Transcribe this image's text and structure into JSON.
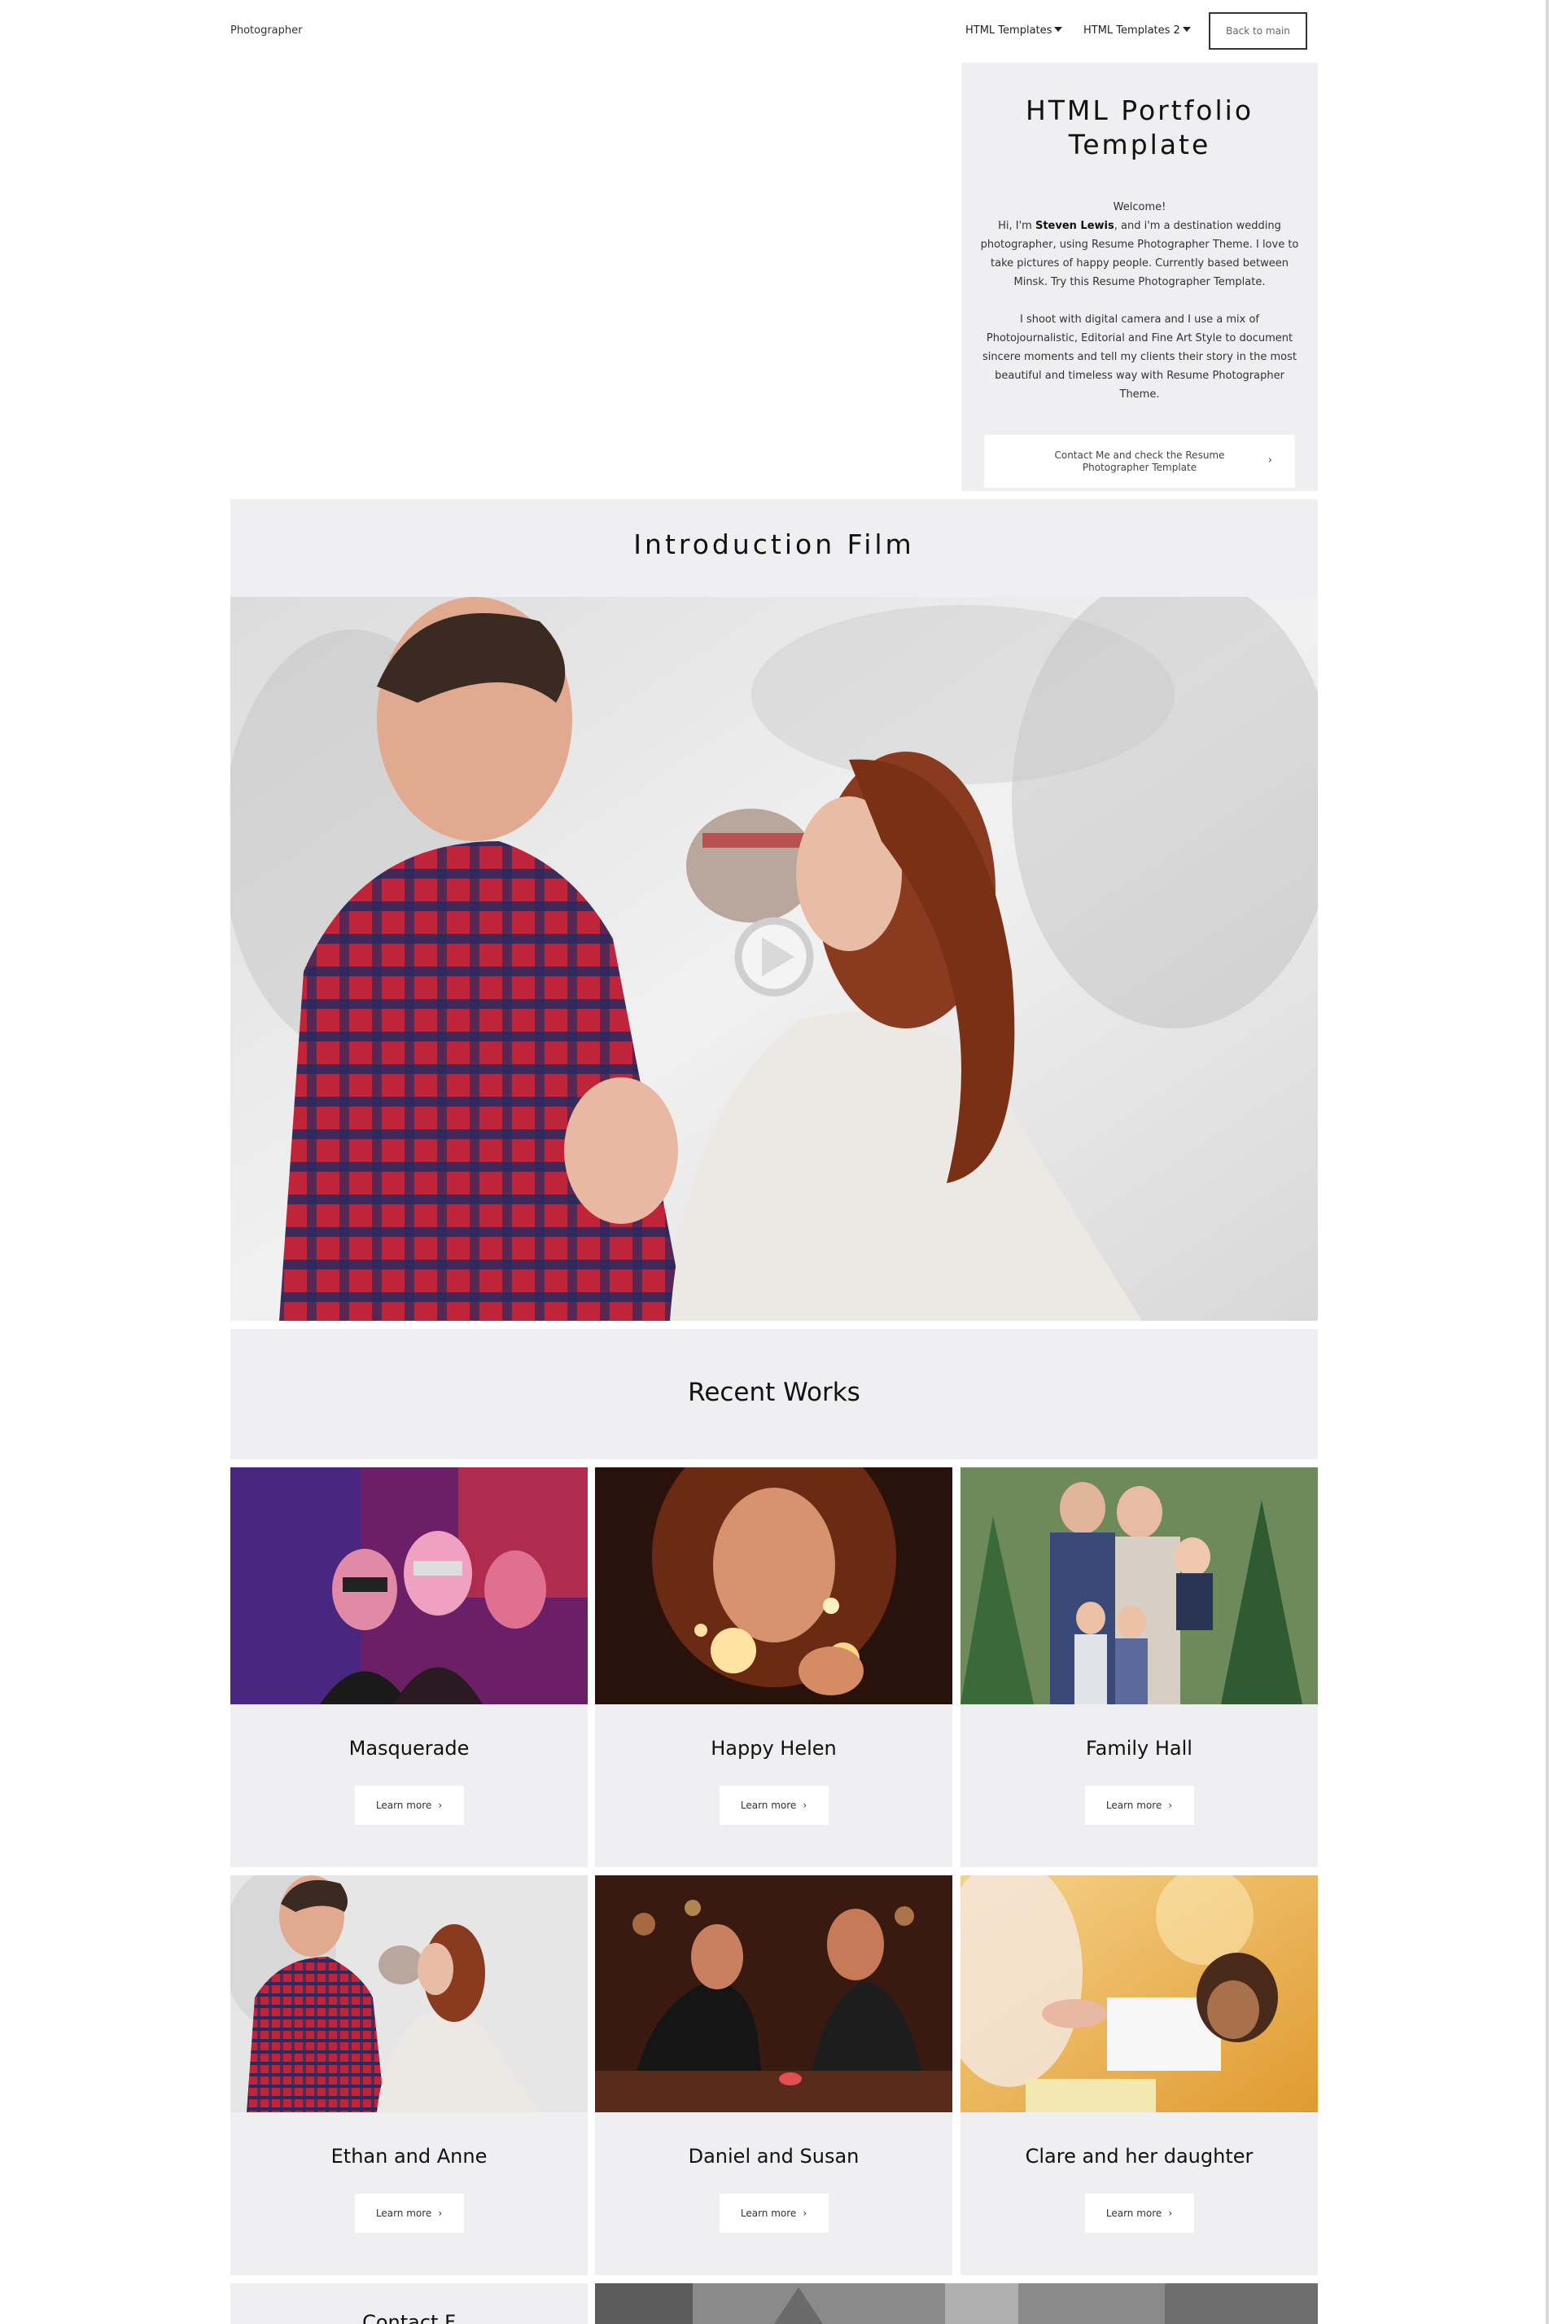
{
  "nav": {
    "brand": "Photographer",
    "menu1": "HTML Templates",
    "menu2": "HTML Templates 2",
    "back_button": "Back to main"
  },
  "intro": {
    "title": "HTML Portfolio Template",
    "welcome": "Welcome!",
    "p1_pre": "Hi, I'm ",
    "p1_name": "Steven Lewis",
    "p1_post": ", and i'm a destination wedding photographer, using Resume Photographer Theme. I love to take pictures of happy people. Currently based between Minsk. Try this Resume Photographer Template.",
    "p2": "I shoot with digital camera and I use a mix of Photojournalistic, Editorial and Fine Art Style to document sincere moments and tell my clients their story in the most beautiful and timeless way with Resume Photographer Theme.",
    "contact_button": "Contact Me and check the Resume Photographer Template"
  },
  "film": {
    "title": "Introduction Film",
    "play_icon": "play-icon"
  },
  "recent": {
    "title": "Recent Works",
    "learn_more": "Learn more",
    "items": [
      {
        "title": "Masquerade"
      },
      {
        "title": "Happy Helen"
      },
      {
        "title": "Family Hall"
      },
      {
        "title": "Ethan and Anne"
      },
      {
        "title": "Daniel and Susan"
      },
      {
        "title": "Clare and her daughter"
      }
    ]
  },
  "bottom": {
    "partial_title": "Contact F"
  },
  "colors": {
    "panel": "#efeef0",
    "text": "#111111"
  }
}
